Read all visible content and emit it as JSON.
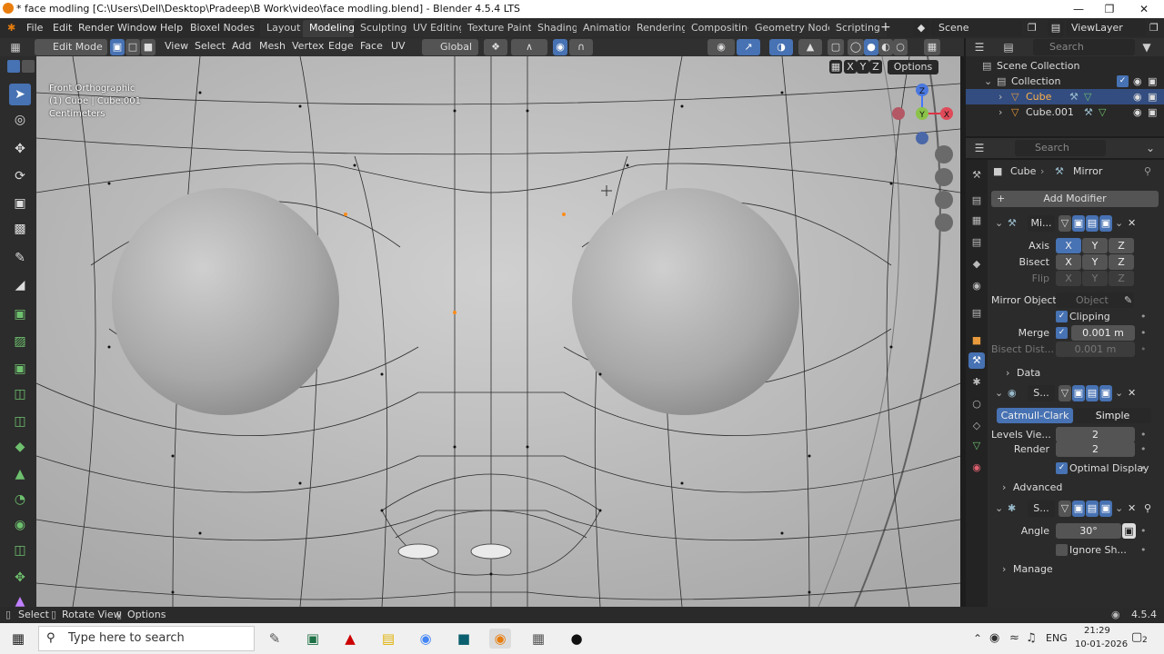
{
  "window": {
    "title": "* face modling [C:\\Users\\Dell\\Desktop\\Pradeep\\B Work\\video\\face modling.blend] - Blender 4.5.4 LTS"
  },
  "menu": [
    "File",
    "Edit",
    "Render",
    "Window",
    "Help",
    "Bioxel Nodes"
  ],
  "workspaces": [
    "Layout",
    "Modeling",
    "Sculpting",
    "UV Editing",
    "Texture Paint",
    "Shading",
    "Animation",
    "Rendering",
    "Compositing",
    "Geometry Nodes",
    "Scripting"
  ],
  "active_workspace": "Modeling",
  "scene": "Scene",
  "view_layer": "ViewLayer",
  "viewport_header": {
    "mode": "Edit Mode",
    "menus": [
      "View",
      "Select",
      "Add",
      "Mesh",
      "Vertex",
      "Edge",
      "Face",
      "UV"
    ],
    "orientation": "Global",
    "axes": [
      "X",
      "Y",
      "Z"
    ],
    "options": "Options"
  },
  "viewport_overlay": {
    "line1": "Front Orthographic",
    "line2": "(1) Cube | Cube.001",
    "line3": "Centimeters"
  },
  "gizmo": {
    "x": "X",
    "y": "Y",
    "z": "Z"
  },
  "outliner": {
    "search_placeholder": "Search",
    "root": "Scene Collection",
    "collection": "Collection",
    "items": [
      "Cube",
      "Cube.001"
    ]
  },
  "properties": {
    "search_placeholder": "Search",
    "breadcrumb_object": "Cube",
    "breadcrumb_modifier": "Mirror",
    "add_modifier": "Add Modifier",
    "mirror": {
      "name": "Mi...",
      "axis_label": "Axis",
      "bisect_label": "Bisect",
      "flip_label": "Flip",
      "axes": [
        "X",
        "Y",
        "Z"
      ],
      "mirror_object_label": "Mirror Object",
      "mirror_object_placeholder": "Object",
      "clipping_label": "Clipping",
      "merge_label": "Merge",
      "merge_value": "0.001 m",
      "bisect_dist_label": "Bisect Dist...",
      "bisect_dist_value": "0.001 m",
      "data_label": "Data"
    },
    "subsurf": {
      "name": "S...",
      "catmull": "Catmull-Clark",
      "simple": "Simple",
      "levels_label": "Levels Vie...",
      "levels_value": "2",
      "render_label": "Render",
      "render_value": "2",
      "optimal_label": "Optimal Display",
      "advanced_label": "Advanced"
    },
    "smooth": {
      "name": "S...",
      "angle_label": "Angle",
      "angle_value": "30°",
      "ignore_label": "Ignore Sh...",
      "manage_label": "Manage"
    }
  },
  "statusbar": {
    "select": "Select",
    "rotate": "Rotate View",
    "options": "Options",
    "version": "4.5.4"
  },
  "taskbar": {
    "search_placeholder": "Type here to search",
    "lang": "ENG",
    "time": "21:29",
    "date": "10-01-2026",
    "notifications": "2"
  },
  "colors": {
    "accent": "#4772b3",
    "viewport_bg": "#c5c5c5",
    "panel_bg": "#2b2b2b",
    "selected_vertex": "#ff8c1a"
  }
}
